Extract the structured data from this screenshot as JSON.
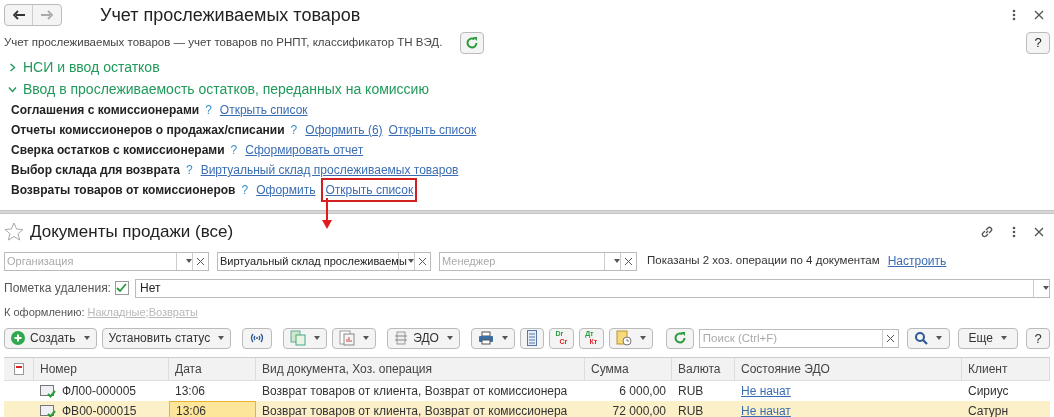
{
  "top": {
    "title": "Учет прослеживаемых товаров",
    "description": "Учет прослеживаемых товаров — учет товаров по РНПТ, классификатор ТН ВЭД.",
    "help": "?",
    "sections": [
      {
        "title": "НСИ и ввод остатков",
        "expanded": false
      },
      {
        "title": "Ввод в прослеживаемость остатков, переданных на комиссию",
        "expanded": true,
        "rows": [
          {
            "label": "Соглашения с комиссионерами",
            "hint": "?",
            "links": [
              {
                "text": "Открыть список",
                "highlighted": false
              }
            ]
          },
          {
            "label": "Отчеты комиссионеров о продажах/списании",
            "hint": "?",
            "links": [
              {
                "text": "Оформить (6)",
                "highlighted": false
              },
              {
                "text": "Открыть список",
                "highlighted": false
              }
            ]
          },
          {
            "label": "Сверка остатков с комиссионерами",
            "hint": "?",
            "links": [
              {
                "text": "Сформировать отчет",
                "highlighted": false
              }
            ]
          },
          {
            "label": "Выбор склада для возврата",
            "hint": "?",
            "links": [
              {
                "text": "Виртуальный склад прослеживаемых товаров",
                "highlighted": false
              }
            ]
          },
          {
            "label": "Возвраты товаров от комиссионеров",
            "hint": "?",
            "links": [
              {
                "text": "Оформить",
                "highlighted": false
              },
              {
                "text": "Открыть список",
                "highlighted": true
              }
            ]
          }
        ]
      }
    ]
  },
  "list": {
    "title": "Документы продажи (все)",
    "favorite": false,
    "filters": [
      {
        "placeholder": "Организация"
      },
      {
        "value": "Виртуальный склад прослеживаемы"
      },
      {
        "placeholder": "Менеджер"
      }
    ],
    "info": "Показаны 2 хоз. операции по 4 документам",
    "configure": "Настроить",
    "deletion": {
      "label": "Пометка удаления:",
      "checked": true,
      "value": "Нет"
    },
    "pending": {
      "label": "К оформлению:",
      "links": [
        "Накладные",
        "Возвраты"
      ],
      "separator": ";"
    },
    "toolbar": [
      {
        "kind": "plus",
        "label": "Создать",
        "caret": true
      },
      {
        "kind": "text",
        "label": "Установить статус",
        "caret": true
      },
      {
        "kind": "signal",
        "caret": false
      },
      {
        "kind": "copy",
        "caret": true
      },
      {
        "kind": "report",
        "caret": true
      },
      {
        "kind": "edo",
        "label": "ЭДО",
        "caret": true
      },
      {
        "kind": "print",
        "caret": true
      },
      {
        "kind": "list",
        "caret": false
      },
      {
        "kind": "letters",
        "top": "Dr",
        "bottom": "Cr"
      },
      {
        "kind": "letters",
        "top": "Дт",
        "bottom": "Кт"
      },
      {
        "kind": "docs",
        "caret": true
      },
      {
        "kind": "refresh",
        "caret": false
      }
    ],
    "search": {
      "placeholder": "Поиск (Ctrl+F)"
    },
    "more": "Еще",
    "help": "?",
    "columns": [
      "Номер",
      "Дата",
      "Вид документа, Хоз. операция",
      "Сумма",
      "Валюта",
      "Состояние ЭДО",
      "Клиент"
    ],
    "rows": [
      {
        "number": "ФЛ00-000005",
        "date": "13:06",
        "type": "Возврат товаров от клиента, Возврат от комиссионера",
        "sum": "6 000,00",
        "currency": "RUB",
        "edo": "Не начат",
        "client": "Сириус",
        "selected": false
      },
      {
        "number": "ФВ00-000015",
        "date": "13:06",
        "type": "Возврат товаров от клиента, Возврат от комиссионера",
        "sum": "72 000,00",
        "currency": "RUB",
        "edo": "Не начат",
        "client": "Сатурн",
        "selected": true
      }
    ]
  }
}
